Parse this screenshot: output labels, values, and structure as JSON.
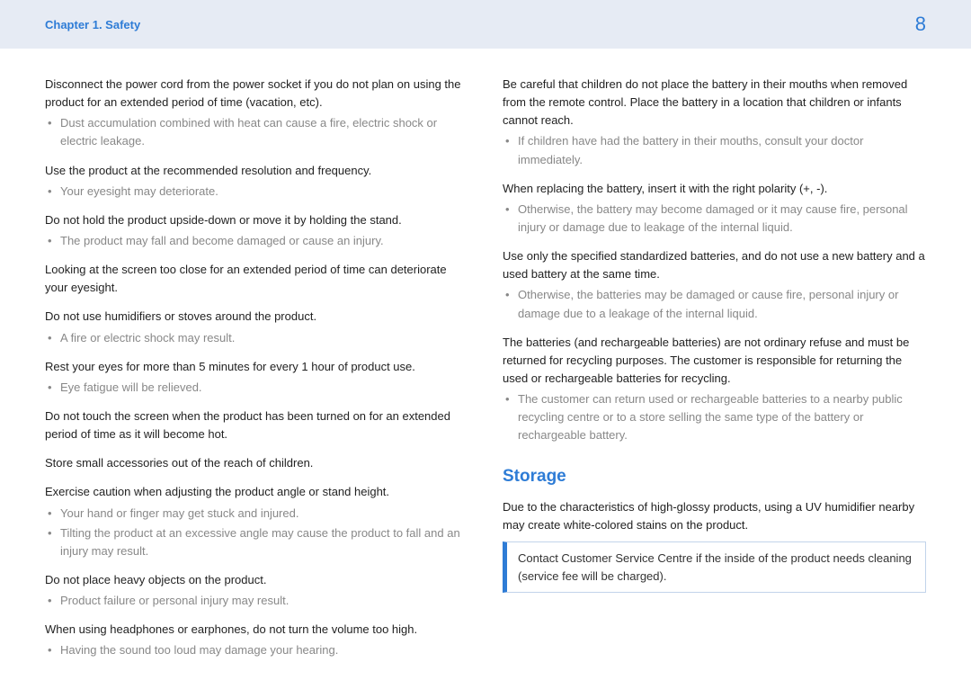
{
  "header": {
    "chapter": "Chapter 1. Safety",
    "page": "8"
  },
  "left": {
    "b1_main": "Disconnect the power cord from the power socket if you do not plan on using the product for an extended period of time (vacation, etc).",
    "b1_sub1": "Dust accumulation combined with heat can cause a fire, electric shock or electric leakage.",
    "b2_main": "Use the product at the recommended resolution and frequency.",
    "b2_sub1": "Your eyesight may deteriorate.",
    "b3_main": "Do not hold the product upside-down or move it by holding the stand.",
    "b3_sub1": "The product may fall and become damaged or cause an injury.",
    "b4_main": "Looking at the screen too close for an extended period of time can deteriorate your eyesight.",
    "b5_main": "Do not use humidifiers or stoves around the product.",
    "b5_sub1": "A fire or electric shock may result.",
    "b6_main": "Rest your eyes for more than 5 minutes for every 1 hour of product use.",
    "b6_sub1": "Eye fatigue will be relieved.",
    "b7_main": "Do not touch the screen when the product has been turned on for an extended period of time as it will become hot.",
    "b8_main": "Store small accessories out of the reach of children.",
    "b9_main": "Exercise caution when adjusting the product angle or stand height.",
    "b9_sub1": "Your hand or finger may get stuck and injured.",
    "b9_sub2": "Tilting the product at an excessive angle may cause the product to fall and an injury may result.",
    "b10_main": "Do not place heavy objects on the product.",
    "b10_sub1": "Product failure or personal injury may result.",
    "b11_main": "When using headphones or earphones, do not turn the volume too high.",
    "b11_sub1": "Having the sound too loud may damage your hearing."
  },
  "right": {
    "b1_main": "Be careful that children do not place the battery in their mouths when removed from the remote control. Place the battery in a location that children or infants cannot reach.",
    "b1_sub1": "If children have had the battery in their mouths, consult your doctor immediately.",
    "b2_main": "When replacing the battery, insert it with the right polarity (+, -).",
    "b2_sub1": "Otherwise, the battery may become damaged or it may cause fire, personal injury or damage due to leakage of the internal liquid.",
    "b3_main": "Use only the specified standardized batteries, and do not use a new battery and a used battery at the same time.",
    "b3_sub1": "Otherwise, the batteries may be damaged or cause fire, personal injury or damage due to a leakage of the internal liquid.",
    "b4_main": "The batteries (and rechargeable batteries) are not ordinary refuse and must be returned for recycling purposes. The customer is responsible for returning the used or rechargeable batteries for recycling.",
    "b4_sub1": "The customer can return used or rechargeable batteries to a nearby public recycling centre or to a store selling the same type of the battery or rechargeable battery.",
    "storage_heading": "Storage",
    "storage_text": "Due to the characteristics of high-glossy products, using a UV humidifier nearby may create white-colored stains on the product.",
    "storage_box": "Contact Customer Service Centre if the inside of the product needs cleaning (service fee will be charged)."
  }
}
